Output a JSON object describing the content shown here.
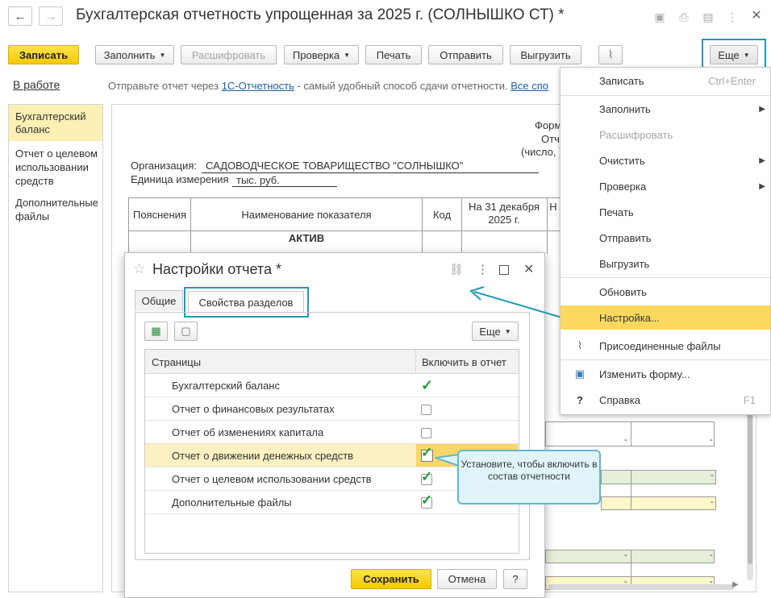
{
  "window": {
    "title": "Бухгалтерская отчетность упрощенная за 2025 г. (СОЛНЫШКО СТ) *"
  },
  "toolbar": {
    "save": "Записать",
    "fill": "Заполнить",
    "decode": "Расшифровать",
    "check": "Проверка",
    "print": "Печать",
    "send": "Отправить",
    "export": "Выгрузить",
    "more": "Еще"
  },
  "statusbar": {
    "status_link": "В работе",
    "message": "Отправьте отчет через",
    "service_link": "1С-Отчетность",
    "message_tail": " - самый удобный способ сдачи отчетности.",
    "all_link": "Все спо"
  },
  "sidebar": {
    "items": [
      {
        "label": "Бухгалтерский баланс"
      },
      {
        "label": "Отчет о целевом использовании средств"
      },
      {
        "label": "Дополнительные файлы"
      }
    ]
  },
  "report": {
    "form_line1": "Форм",
    "form_line2": "Отч",
    "form_line3": "(число, )",
    "org_label": "Организация:",
    "org_value": "САДОВОДЧЕСКОЕ ТОВАРИЩЕСТВО \"СОЛНЫШКО\"",
    "unit_label": "Единица измерения",
    "unit_value": "тыс. руб.",
    "headers": {
      "notes": "Пояснения",
      "indicator": "Наименование показателя",
      "code": "Код",
      "date": "На 31 декабря 2025 г.",
      "next": "Н"
    },
    "section": "АКТИВ",
    "dash": "-"
  },
  "more_menu": {
    "items": [
      {
        "label": "Записать",
        "shortcut": "Ctrl+Enter"
      },
      {
        "label": "Заполнить",
        "submenu": true
      },
      {
        "label": "Расшифровать",
        "disabled": true
      },
      {
        "label": "Очистить",
        "submenu": true
      },
      {
        "label": "Проверка",
        "submenu": true
      },
      {
        "label": "Печать"
      },
      {
        "label": "Отправить"
      },
      {
        "label": "Выгрузить"
      },
      {
        "label": "Обновить"
      },
      {
        "label": "Настройка...",
        "selected": true
      },
      {
        "label": "Присоединенные файлы",
        "icon": "paperclip-icon"
      },
      {
        "label": "Изменить форму...",
        "icon": "form-settings-icon"
      },
      {
        "label": "Справка",
        "shortcut": "F1",
        "icon": "help-icon"
      }
    ]
  },
  "dialog": {
    "title": "Настройки отчета *",
    "tabs": [
      {
        "label": "Общие"
      },
      {
        "label": "Свойства разделов",
        "active": true
      }
    ],
    "more": "Еще",
    "columns": {
      "pages": "Страницы",
      "include": "Включить в отчет"
    },
    "rows": [
      {
        "label": "Бухгалтерский баланс",
        "checked": true,
        "style": "checkmark"
      },
      {
        "label": "Отчет о финансовых результатах",
        "checked": false
      },
      {
        "label": "Отчет об изменениях капитала",
        "checked": false
      },
      {
        "label": "Отчет о движении денежных средств",
        "checked": true,
        "highlighted": true
      },
      {
        "label": "Отчет о целевом использовании средств",
        "checked": true
      },
      {
        "label": "Дополнительные файлы",
        "checked": true
      }
    ],
    "save": "Сохранить",
    "cancel": "Отмена",
    "help": "?"
  },
  "callout": {
    "text": "Установите, чтобы включить в состав отчетности"
  },
  "colors": {
    "accent_yellow": "#f5c800",
    "highlight_blue": "#1f9bb5",
    "menu_selected": "#fcd95e",
    "row_highlight": "#fdf0c2",
    "check_green": "#1f9a3b"
  }
}
